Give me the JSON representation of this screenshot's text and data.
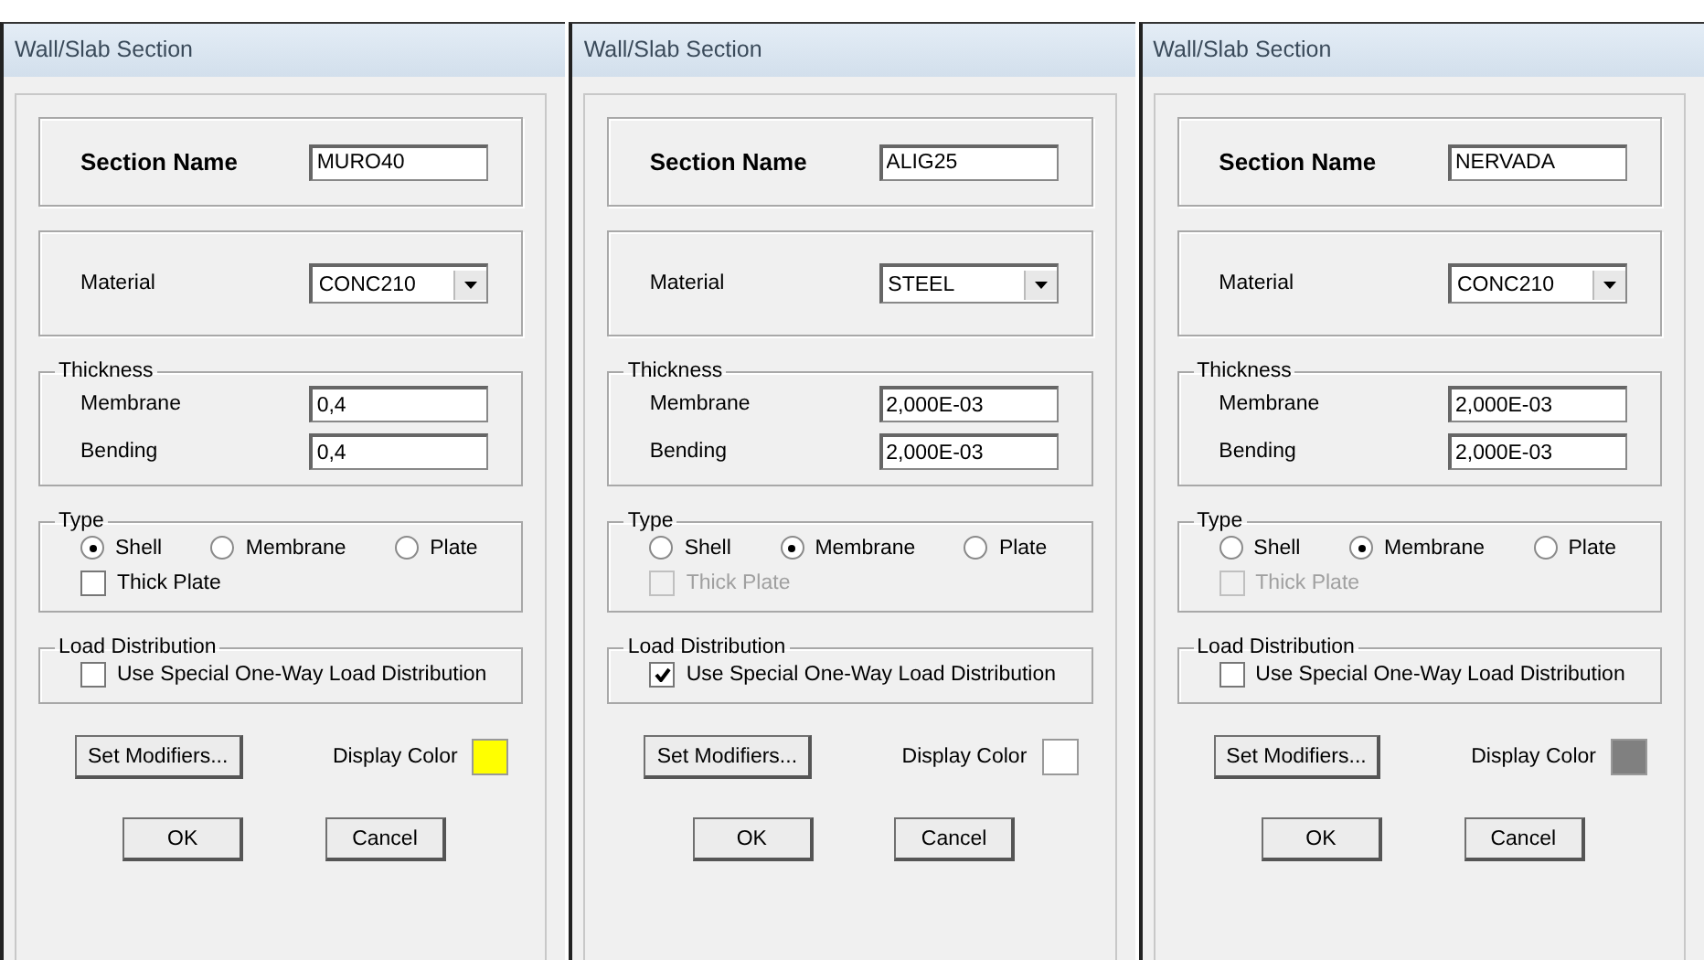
{
  "dialogs": [
    {
      "title": "Wall/Slab Section",
      "section_name_label": "Section Name",
      "section_name": "MURO40",
      "material_label": "Material",
      "material": "CONC210",
      "thickness": {
        "title": "Thickness",
        "rows": [
          {
            "label": "Membrane",
            "value": "0,4"
          },
          {
            "label": "Bending",
            "value": "0,4"
          }
        ]
      },
      "type": {
        "title": "Type",
        "options": [
          {
            "label": "Shell",
            "selected": true
          },
          {
            "label": "Membrane",
            "selected": false
          },
          {
            "label": "Plate",
            "selected": false
          }
        ],
        "thick_plate": {
          "label": "Thick Plate",
          "checked": false,
          "disabled": false
        }
      },
      "load_distribution": {
        "title": "Load Distribution",
        "option": {
          "label": "Use Special One-Way Load Distribution",
          "checked": false
        }
      },
      "modifiers_button": "Set Modifiers...",
      "display_color": {
        "label": "Display Color",
        "color": "#ffff00"
      },
      "buttons": [
        "OK",
        "Cancel"
      ]
    },
    {
      "title": "Wall/Slab Section",
      "section_name_label": "Section Name",
      "section_name": "ALIG25",
      "material_label": "Material",
      "material": "STEEL",
      "thickness": {
        "title": "Thickness",
        "rows": [
          {
            "label": "Membrane",
            "value": "2,000E-03"
          },
          {
            "label": "Bending",
            "value": "2,000E-03"
          }
        ]
      },
      "type": {
        "title": "Type",
        "options": [
          {
            "label": "Shell",
            "selected": false
          },
          {
            "label": "Membrane",
            "selected": true
          },
          {
            "label": "Plate",
            "selected": false
          }
        ],
        "thick_plate": {
          "label": "Thick Plate",
          "checked": false,
          "disabled": true
        }
      },
      "load_distribution": {
        "title": "Load Distribution",
        "option": {
          "label": "Use Special One-Way Load Distribution",
          "checked": true
        }
      },
      "modifiers_button": "Set Modifiers...",
      "display_color": {
        "label": "Display Color",
        "color": "#ffffff"
      },
      "buttons": [
        "OK",
        "Cancel"
      ]
    },
    {
      "title": "Wall/Slab Section",
      "section_name_label": "Section Name",
      "section_name": "NERVADA",
      "material_label": "Material",
      "material": "CONC210",
      "thickness": {
        "title": "Thickness",
        "rows": [
          {
            "label": "Membrane",
            "value": "2,000E-03"
          },
          {
            "label": "Bending",
            "value": "2,000E-03"
          }
        ]
      },
      "type": {
        "title": "Type",
        "options": [
          {
            "label": "Shell",
            "selected": false
          },
          {
            "label": "Membrane",
            "selected": true
          },
          {
            "label": "Plate",
            "selected": false
          }
        ],
        "thick_plate": {
          "label": "Thick Plate",
          "checked": false,
          "disabled": true
        }
      },
      "load_distribution": {
        "title": "Load Distribution",
        "option": {
          "label": "Use Special One-Way Load Distribution",
          "checked": false
        }
      },
      "modifiers_button": "Set Modifiers...",
      "display_color": {
        "label": "Display Color",
        "color": "#808080"
      },
      "buttons": [
        "OK",
        "Cancel"
      ]
    }
  ]
}
